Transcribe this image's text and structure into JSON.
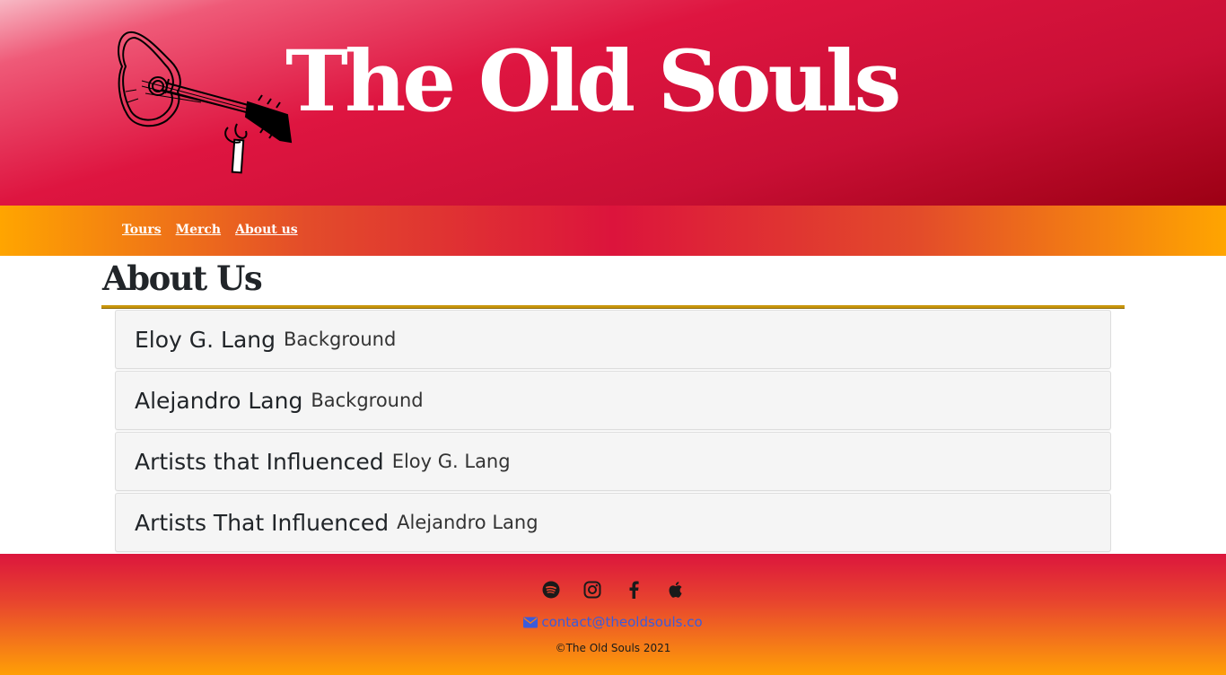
{
  "header": {
    "site_title": "The Old Souls",
    "logo_icon": "guitar-icon"
  },
  "nav": {
    "items": [
      {
        "label": "Tours"
      },
      {
        "label": "Merch"
      },
      {
        "label": "About us"
      }
    ]
  },
  "main": {
    "page_title": "About Us",
    "accordion": [
      {
        "title": "Eloy G. Lang",
        "subtitle": "Background"
      },
      {
        "title": "Alejandro Lang",
        "subtitle": "Background"
      },
      {
        "title": "Artists that Influenced",
        "subtitle": "Eloy G. Lang"
      },
      {
        "title": "Artists That Influenced",
        "subtitle": "Alejandro Lang"
      }
    ]
  },
  "footer": {
    "social_icons": [
      "spotify-icon",
      "instagram-icon",
      "facebook-icon",
      "apple-icon"
    ],
    "contact_email": "contact@theoldsouls.co",
    "copyright": "©The Old Souls 2021"
  },
  "colors": {
    "header_red": "#dc143c",
    "nav_orange": "#ffa500",
    "rule_gold": "#c8960c",
    "link_blue": "#3b5bdb"
  }
}
